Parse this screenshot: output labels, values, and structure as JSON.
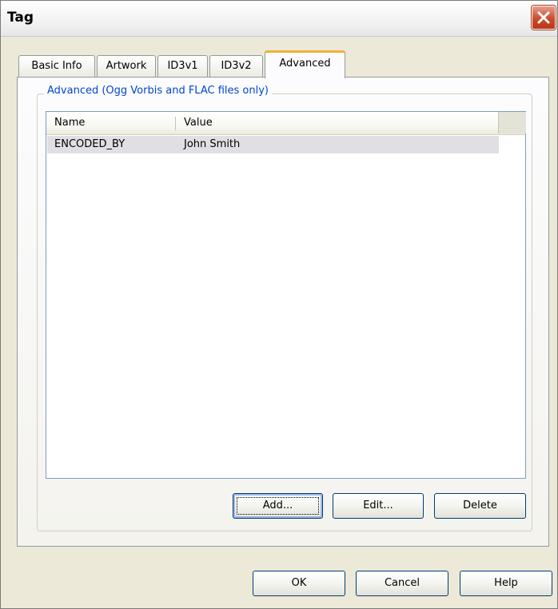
{
  "window": {
    "title": "Tag"
  },
  "tabs": [
    {
      "label": "Basic Info"
    },
    {
      "label": "Artwork"
    },
    {
      "label": "ID3v1"
    },
    {
      "label": "ID3v2"
    },
    {
      "label": "Advanced",
      "active": true
    }
  ],
  "group": {
    "title": "Advanced  (Ogg Vorbis and FLAC files only)"
  },
  "list": {
    "columns": [
      "Name",
      "Value"
    ],
    "rows": [
      {
        "name": "ENCODED_BY",
        "value": "John Smith"
      }
    ]
  },
  "panel_buttons": {
    "add": "Add...",
    "edit": "Edit...",
    "delete": "Delete"
  },
  "dialog_buttons": {
    "ok": "OK",
    "cancel": "Cancel",
    "help": "Help"
  },
  "colors": {
    "accent_tab": "#f1b03b",
    "group_title": "#0046d5",
    "close_button": "#cc4a2a"
  }
}
